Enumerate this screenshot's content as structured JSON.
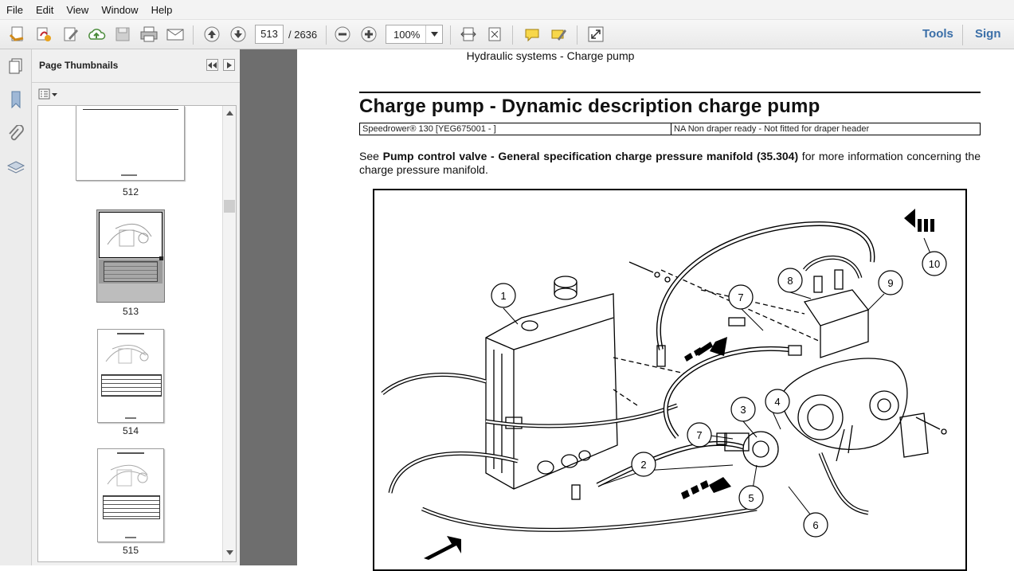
{
  "menu": [
    "File",
    "Edit",
    "View",
    "Window",
    "Help"
  ],
  "toolbar": {
    "current_page": "513",
    "total_pages": "/ 2636",
    "zoom": "100%",
    "tools_label": "Tools",
    "sign_label": "Sign"
  },
  "panel": {
    "title": "Page Thumbnails",
    "thumbnails": [
      {
        "label": "512",
        "selected": false
      },
      {
        "label": "513",
        "selected": true
      },
      {
        "label": "514",
        "selected": false
      },
      {
        "label": "515",
        "selected": false
      }
    ]
  },
  "document": {
    "running_header": "Hydraulic systems - Charge pump",
    "heading": "Charge pump - Dynamic description charge pump",
    "spec_left": "Speedrower® 130 [YEG675001 - ]",
    "spec_right": "NA Non draper ready - Not fitted for draper header",
    "para_pre": "See ",
    "para_bold": "Pump control valve - General specification charge pressure manifold (35.304)",
    "para_post": " for more information concerning the charge pressure manifold.",
    "callouts": [
      "1",
      "7",
      "8",
      "9",
      "10",
      "3",
      "4",
      "7",
      "2",
      "5",
      "6"
    ]
  }
}
